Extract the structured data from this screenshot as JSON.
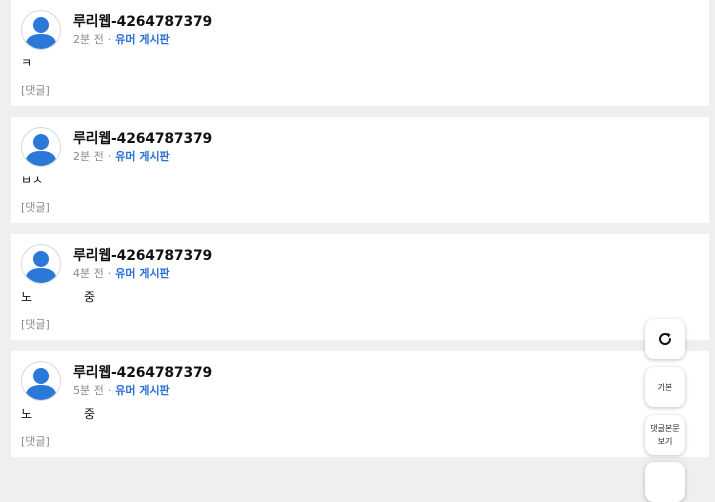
{
  "posts": [
    {
      "username": "루리웹-4264787379",
      "time": "2분 전",
      "board": "유머 게시판",
      "text": "ㅋ",
      "comment_tag": "[댓글]"
    },
    {
      "username": "루리웹-4264787379",
      "time": "2분 전",
      "board": "유머 게시판",
      "text": "ㅂㅅ",
      "comment_tag": "[댓글]"
    },
    {
      "username": "루리웹-4264787379",
      "time": "4분 전",
      "board": "유머 게시판",
      "text_start": "노",
      "text_end": "중",
      "comment_tag": "[댓글]"
    },
    {
      "username": "루리웹-4264787379",
      "time": "5분 전",
      "board": "유머 게시판",
      "text_start": "노",
      "text_end": "중",
      "comment_tag": "[댓글]"
    }
  ],
  "meta_separator": "·",
  "floating_buttons": {
    "refresh_icon": "refresh-icon",
    "basic_label": "기본",
    "comment_body_label": "댓글본문 보기"
  },
  "colors": {
    "board_link": "#2a6fd6",
    "avatar": "#2b78d8",
    "page_bg": "#efefef"
  }
}
